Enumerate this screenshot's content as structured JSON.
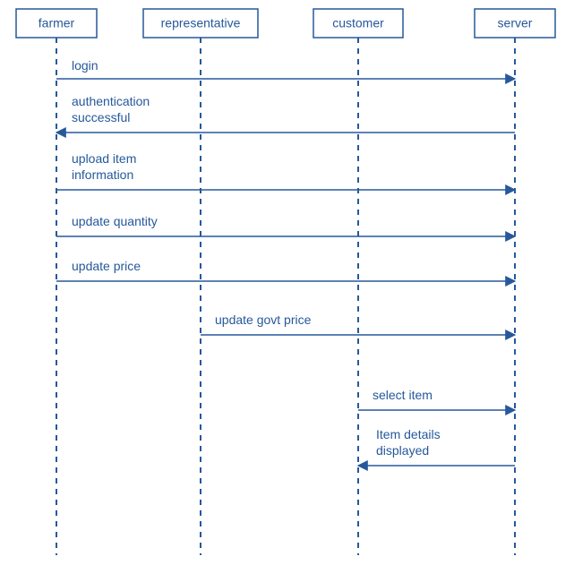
{
  "participants": {
    "p0": "farmer",
    "p1": "representative",
    "p2": "customer",
    "p3": "server"
  },
  "messages": {
    "m0": {
      "label": "login"
    },
    "m1": {
      "label_l1": "authentication",
      "label_l2": "successful"
    },
    "m2": {
      "label_l1": "upload item",
      "label_l2": "information"
    },
    "m3": {
      "label": "update quantity"
    },
    "m4": {
      "label": "update price"
    },
    "m5": {
      "label": "update govt price"
    },
    "m6": {
      "label": "select item"
    },
    "m7": {
      "label_l1": "Item details",
      "label_l2": "displayed"
    }
  },
  "chart_data": {
    "type": "sequence-diagram",
    "participants": [
      "farmer",
      "representative",
      "customer",
      "server"
    ],
    "messages": [
      {
        "from": "farmer",
        "to": "server",
        "label": "login"
      },
      {
        "from": "server",
        "to": "farmer",
        "label": "authentication successful"
      },
      {
        "from": "farmer",
        "to": "server",
        "label": "upload item information"
      },
      {
        "from": "farmer",
        "to": "server",
        "label": "update quantity"
      },
      {
        "from": "farmer",
        "to": "server",
        "label": "update price"
      },
      {
        "from": "representative",
        "to": "server",
        "label": "update govt price"
      },
      {
        "from": "customer",
        "to": "server",
        "label": "select item"
      },
      {
        "from": "server",
        "to": "customer",
        "label": "Item details displayed"
      }
    ]
  }
}
